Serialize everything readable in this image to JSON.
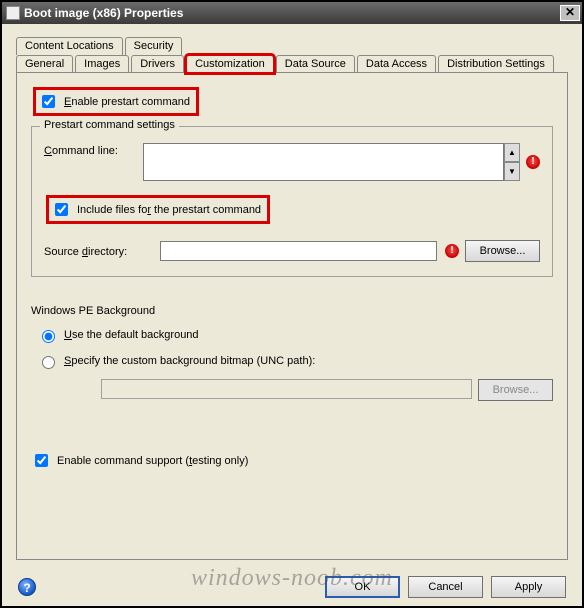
{
  "window": {
    "title": "Boot image (x86) Properties",
    "close_glyph": "✕"
  },
  "tabs": {
    "row1": [
      "Content Locations",
      "Security"
    ],
    "row2": [
      "General",
      "Images",
      "Drivers",
      "Customization",
      "Data Source",
      "Data Access",
      "Distribution Settings"
    ],
    "selected": "Customization"
  },
  "customization": {
    "enable_prestart": {
      "checked": true,
      "label_prefix": "E",
      "label_rest": "nable prestart command"
    },
    "group_title": "Prestart command settings",
    "command_line": {
      "label_prefix": "C",
      "label_rest": "ommand line:",
      "value": ""
    },
    "include_files": {
      "checked": true,
      "label_pre": "Include files fo",
      "label_key": "r",
      "label_post": " the prestart command"
    },
    "source_dir": {
      "label_pre": "Source ",
      "label_key": "d",
      "label_post": "irectory:",
      "value": "",
      "browse_label": "Browse..."
    },
    "pe_bg": {
      "title": "Windows PE Background",
      "use_default": {
        "selected": true,
        "label_key": "U",
        "label_rest": "se the default background"
      },
      "specify": {
        "selected": false,
        "label_pre": "S",
        "label_rest": "pecify the custom background bitmap (UNC path):"
      },
      "unc_value": "",
      "browse_label": "Browse..."
    },
    "testing": {
      "checked": true,
      "label_pre": "Enable command support (",
      "label_key": "t",
      "label_post": "esting only)"
    }
  },
  "buttons": {
    "ok": "OK",
    "cancel": "Cancel",
    "apply": "Apply"
  },
  "watermark": "windows-noob.com",
  "glyphs": {
    "warn": "!",
    "help": "?",
    "up": "▲",
    "down": "▼"
  }
}
